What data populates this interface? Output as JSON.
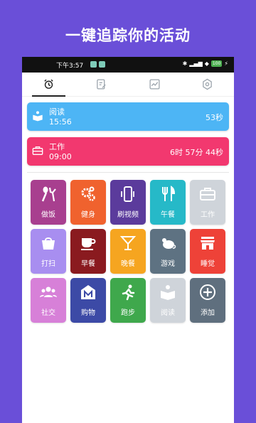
{
  "headline": "一键追踪你的活动",
  "statusbar": {
    "time": "下午3:57",
    "signal": "ᯤ",
    "battery": "100"
  },
  "tabs": [
    {
      "name": "tab-alarm",
      "icon": "alarm-clock-icon",
      "active": true
    },
    {
      "name": "tab-notes",
      "icon": "note-edit-icon",
      "active": false
    },
    {
      "name": "tab-stats",
      "icon": "trend-chart-icon",
      "active": false
    },
    {
      "name": "tab-settings",
      "icon": "gear-icon",
      "active": false
    }
  ],
  "cards": [
    {
      "title": "阅读",
      "time": "15:56",
      "duration": "53秒",
      "color": "#4db5f5",
      "icon": "book-reader-icon"
    },
    {
      "title": "工作",
      "time": "09:00",
      "duration": "6时 57分 44秒",
      "color": "#f2386f",
      "icon": "briefcase-icon"
    }
  ],
  "activities": [
    {
      "label": "做饭",
      "color": "#a83f8f",
      "icon": "spoon-fork-icon"
    },
    {
      "label": "健身",
      "color": "#f0622e",
      "icon": "gears-icon"
    },
    {
      "label": "刷视频",
      "color": "#5b3b9c",
      "icon": "phone-vibrate-icon"
    },
    {
      "label": "午餐",
      "color": "#26b9c8",
      "icon": "fork-knife-icon"
    },
    {
      "label": "工作",
      "color": "#cfd4da",
      "icon": "briefcase-icon"
    },
    {
      "label": "打扫",
      "color": "#a88ef0",
      "icon": "basket-icon"
    },
    {
      "label": "早餐",
      "color": "#8a1a1f",
      "icon": "coffee-cup-icon"
    },
    {
      "label": "晚餐",
      "color": "#f6a520",
      "icon": "cocktail-icon"
    },
    {
      "label": "游戏",
      "color": "#5e7282",
      "icon": "mouse-animal-icon"
    },
    {
      "label": "睡觉",
      "color": "#ee4238",
      "icon": "store-icon"
    },
    {
      "label": "社交",
      "color": "#d780d8",
      "icon": "people-group-icon"
    },
    {
      "label": "购物",
      "color": "#3c4aa6",
      "icon": "shop-m-icon"
    },
    {
      "label": "跑步",
      "color": "#3fa84c",
      "icon": "runner-icon"
    },
    {
      "label": "阅读",
      "color": "#cfd4da",
      "icon": "book-reader-icon"
    },
    {
      "label": "添加",
      "color": "#5f6f7e",
      "icon": "plus-circle-icon"
    }
  ]
}
